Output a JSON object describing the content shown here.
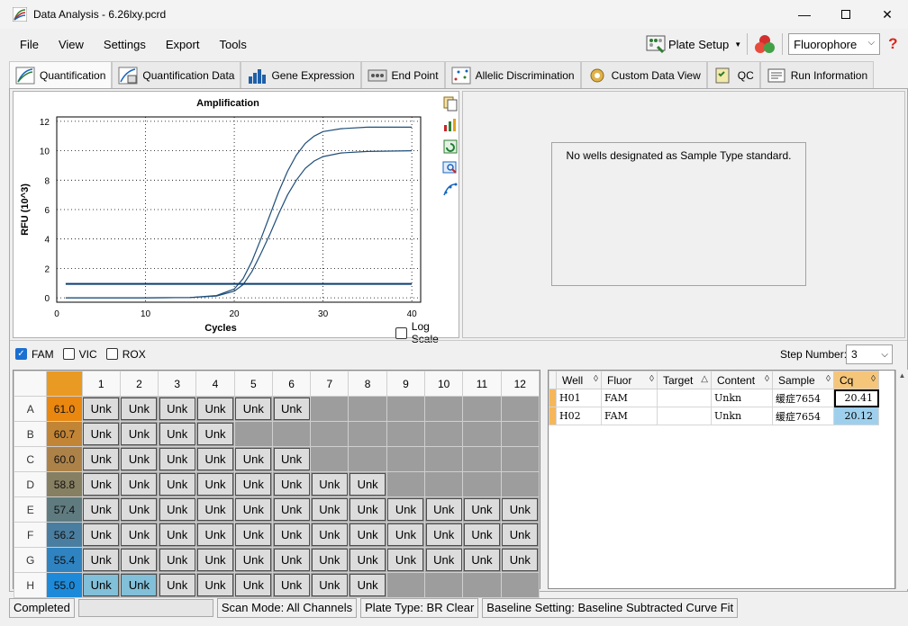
{
  "window": {
    "title": "Data Analysis - 6.26lxy.pcrd"
  },
  "menu": [
    "File",
    "View",
    "Settings",
    "Export",
    "Tools"
  ],
  "toolbar": {
    "plate_setup": "Plate Setup",
    "fluorophore": "Fluorophore",
    "help": "?"
  },
  "tabs": [
    "Quantification",
    "Quantification Data",
    "Gene Expression",
    "End Point",
    "Allelic Discrimination",
    "Custom Data View",
    "QC",
    "Run Information"
  ],
  "chart_data": {
    "type": "line",
    "title": "Amplification",
    "xlabel": "Cycles",
    "ylabel": "RFU (10^3)",
    "xlim": [
      0,
      41
    ],
    "ylim": [
      -0.3,
      12.3
    ],
    "xticks": [
      0,
      10,
      20,
      30,
      40
    ],
    "yticks": [
      0,
      2,
      4,
      6,
      8,
      10,
      12
    ],
    "grid": true,
    "series": [
      {
        "color": "#1f4e79",
        "x": [
          1,
          5,
          10,
          15,
          18,
          20,
          21,
          22,
          23,
          24,
          25,
          26,
          27,
          28,
          29,
          30,
          32,
          35,
          40
        ],
        "y": [
          0.0,
          0.0,
          0.0,
          0.02,
          0.15,
          0.6,
          1.3,
          2.5,
          4.0,
          5.6,
          7.2,
          8.6,
          9.7,
          10.5,
          11.0,
          11.3,
          11.5,
          11.6,
          11.6
        ]
      },
      {
        "color": "#1f4e79",
        "x": [
          1,
          5,
          10,
          15,
          18,
          20,
          21,
          22,
          23,
          24,
          25,
          26,
          27,
          28,
          29,
          30,
          32,
          35,
          40
        ],
        "y": [
          0.0,
          0.0,
          0.0,
          0.02,
          0.12,
          0.45,
          0.9,
          1.8,
          3.0,
          4.3,
          5.7,
          7.0,
          8.0,
          8.8,
          9.3,
          9.6,
          9.85,
          9.95,
          10.0
        ]
      },
      {
        "color": "#0a3d73",
        "threshold": true,
        "x": [
          1,
          40
        ],
        "y": [
          0.95,
          0.95
        ]
      }
    ]
  },
  "chart_ui": {
    "log_scale": "Log Scale"
  },
  "standard_panel": {
    "message": "No wells designated as Sample Type standard."
  },
  "fluors": [
    {
      "label": "FAM",
      "checked": true
    },
    {
      "label": "VIC",
      "checked": false
    },
    {
      "label": "ROX",
      "checked": false
    }
  ],
  "step": {
    "label": "Step Number:",
    "value": "3"
  },
  "plate": {
    "columns": [
      "1",
      "2",
      "3",
      "4",
      "5",
      "6",
      "7",
      "8",
      "9",
      "10",
      "11",
      "12"
    ],
    "rows": [
      {
        "label": "A",
        "temp": "61.0",
        "color": "#e9870f",
        "wells": 6,
        "selected": []
      },
      {
        "label": "B",
        "temp": "60.7",
        "color": "#c28536",
        "wells": 4,
        "selected": []
      },
      {
        "label": "C",
        "temp": "60.0",
        "color": "#ad8248",
        "wells": 6,
        "selected": []
      },
      {
        "label": "D",
        "temp": "58.8",
        "color": "#877f61",
        "wells": 8,
        "selected": []
      },
      {
        "label": "E",
        "temp": "57.4",
        "color": "#5f7b7f",
        "wells": 12,
        "selected": []
      },
      {
        "label": "F",
        "temp": "56.2",
        "color": "#4a7ea0",
        "wells": 12,
        "selected": []
      },
      {
        "label": "G",
        "temp": "55.4",
        "color": "#2f83c0",
        "wells": 12,
        "selected": []
      },
      {
        "label": "H",
        "temp": "55.0",
        "color": "#1d8ad9",
        "wells": 8,
        "selected": [
          0,
          1
        ]
      }
    ],
    "well_label": "Unk"
  },
  "table": {
    "headers": [
      "Well",
      "Fluor",
      "Target",
      "Content",
      "Sample",
      "Cq"
    ],
    "rows": [
      {
        "well": "H01",
        "fluor": "FAM",
        "target": "",
        "content": "Unkn",
        "sample": "缓症7654",
        "cq": "20.41"
      },
      {
        "well": "H02",
        "fluor": "FAM",
        "target": "",
        "content": "Unkn",
        "sample": "缓症7654",
        "cq": "20.12"
      }
    ]
  },
  "status": {
    "state": "Completed",
    "scan_mode": "Scan Mode: All Channels",
    "plate_type": "Plate Type: BR Clear",
    "baseline": "Baseline Setting: Baseline Subtracted Curve Fit"
  }
}
